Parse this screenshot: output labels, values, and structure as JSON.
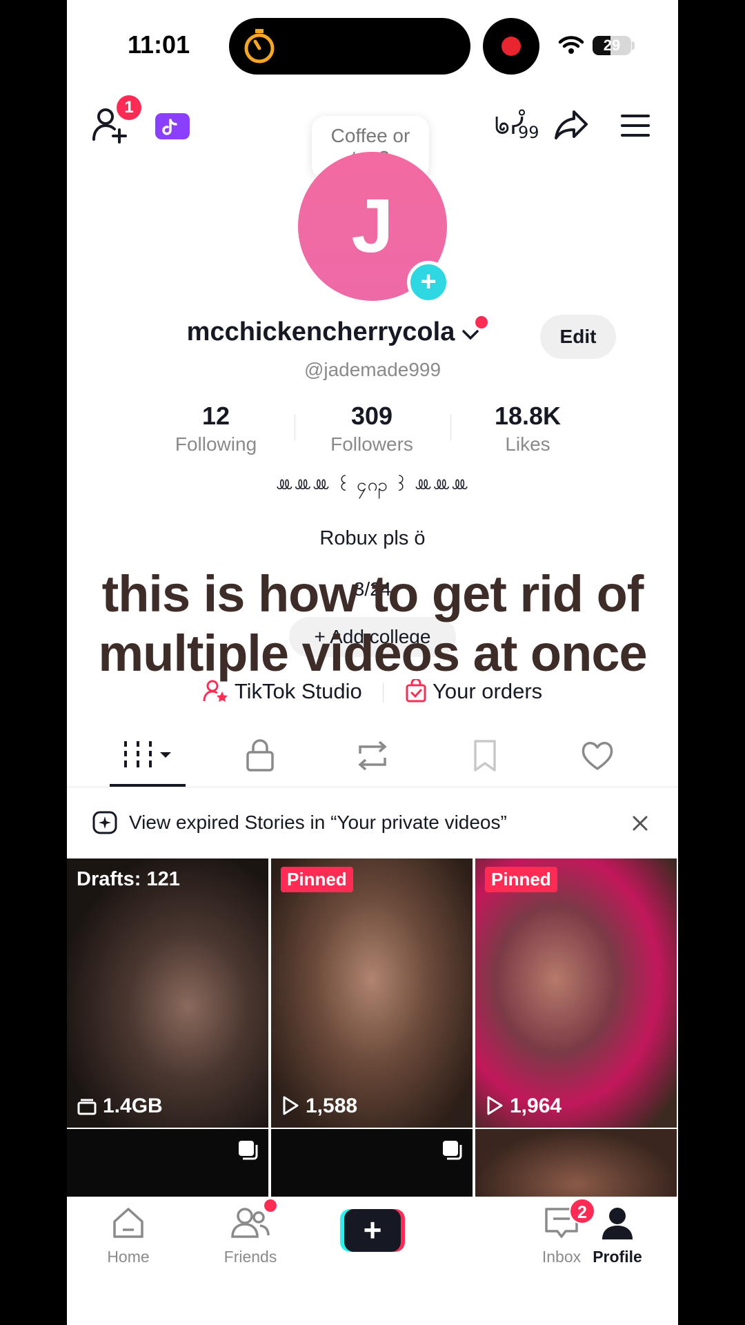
{
  "status_bar": {
    "time": "11:01",
    "battery": "29"
  },
  "header": {
    "friend_requests_badge": "1",
    "speech_bubble": "Coffee or tea?"
  },
  "profile": {
    "avatar_letter": "J",
    "username": "mcchickencherrycola",
    "handle": "@jademade999",
    "edit_label": "Edit",
    "stats": [
      {
        "value": "12",
        "label": "Following"
      },
      {
        "value": "309",
        "label": "Followers"
      },
      {
        "value": "18.8K",
        "label": "Likes"
      }
    ],
    "bio_line1": "ꔛꔛꔛ ꒰ ၄ဂၣ ꒱ ꔛꔛꔛ",
    "bio_line2": "Robux pls ö",
    "bio_line3": "3/24",
    "add_college": "+ Add college",
    "tiktok_studio": "TikTok Studio",
    "your_orders": "Your orders"
  },
  "overlay_caption": "this is how to get rid of multiple videos at once",
  "notice": {
    "text": "View expired Stories in “Your private videos”"
  },
  "grid": [
    {
      "label": "Drafts: 121",
      "foot": "1.4GB"
    },
    {
      "label": "Pinned",
      "foot": "1,588"
    },
    {
      "label": "Pinned",
      "foot": "1,964"
    }
  ],
  "nav": {
    "home": "Home",
    "friends": "Friends",
    "inbox": "Inbox",
    "inbox_badge": "2",
    "profile": "Profile"
  },
  "colors": {
    "accent": "#fe2c55",
    "teal": "#2ed8e3",
    "avatar": "#ee6aa7"
  }
}
